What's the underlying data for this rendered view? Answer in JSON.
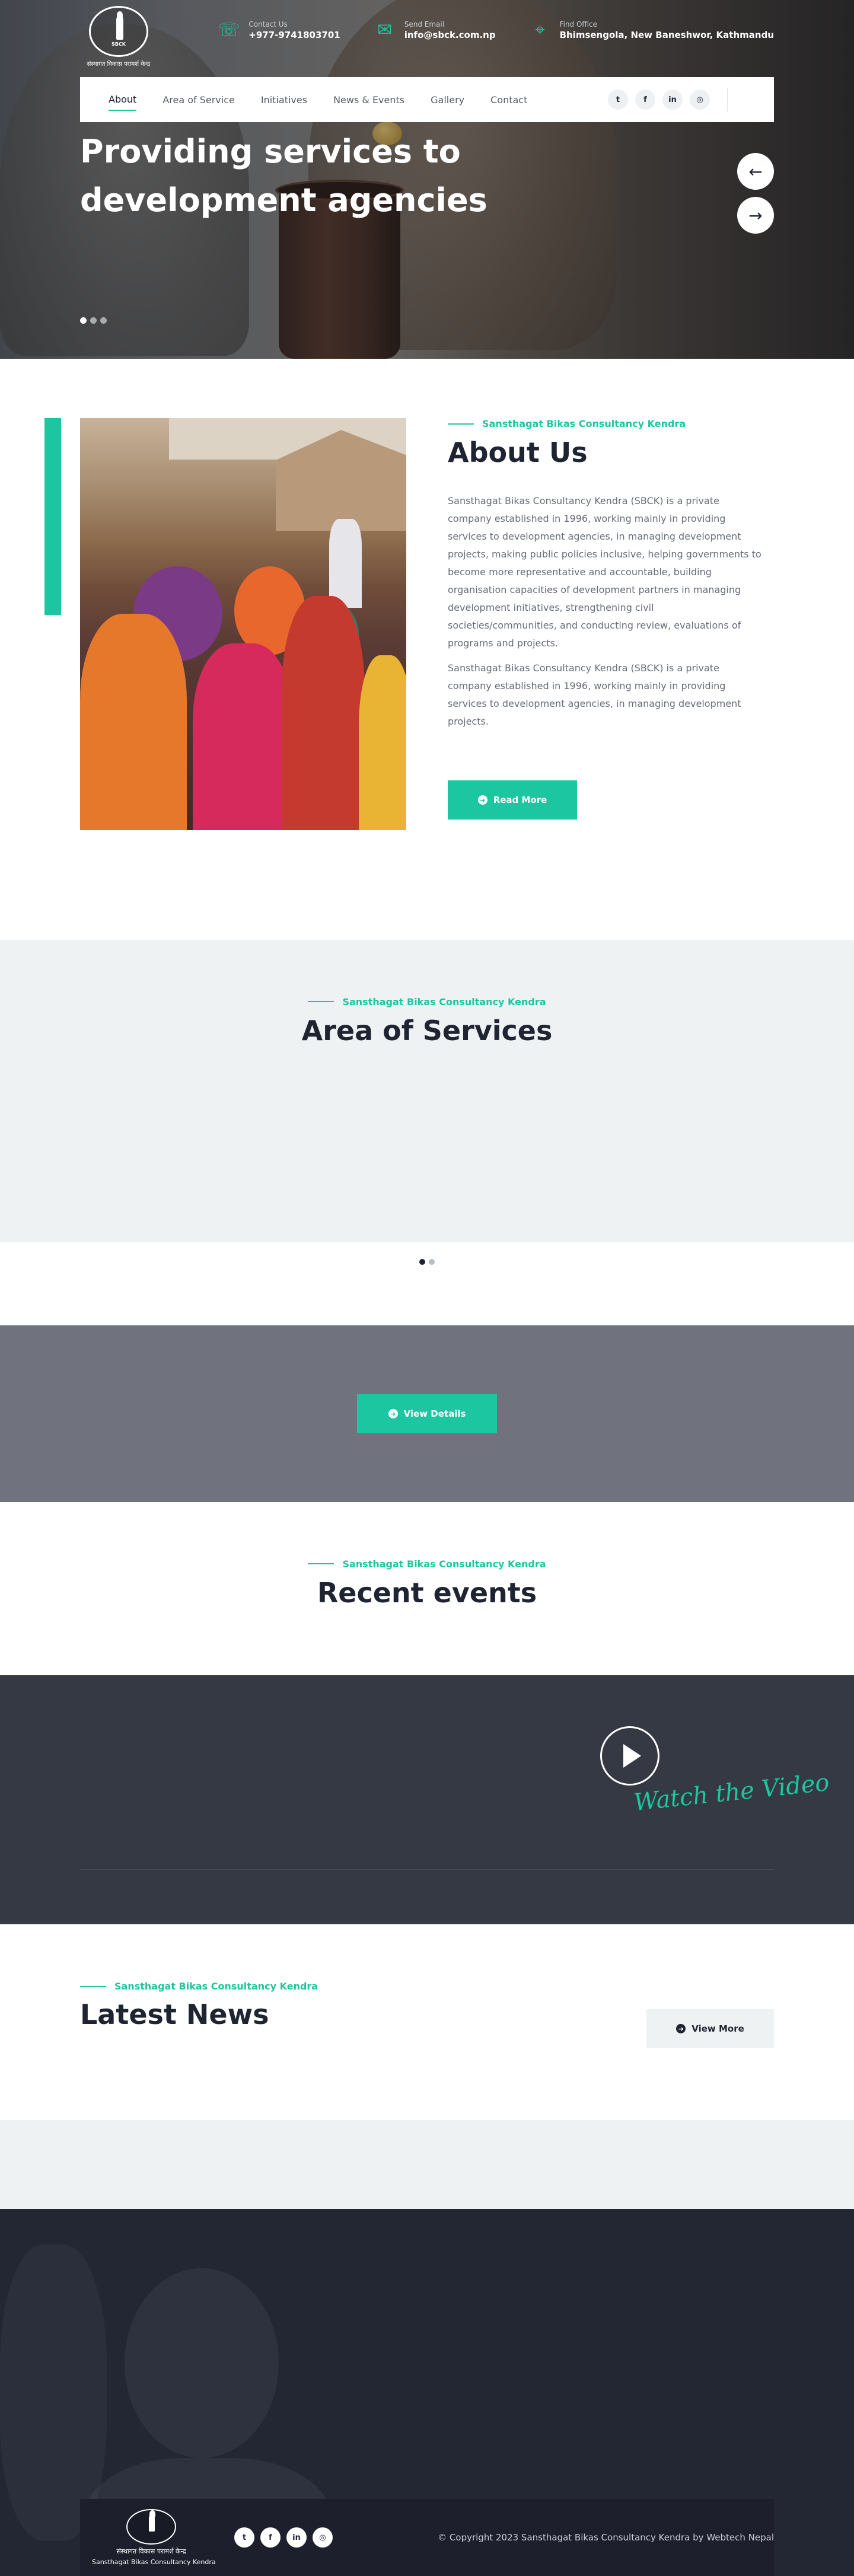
{
  "header": {
    "logo_mark": "SBCK",
    "logo_text": "संस्थागत विकास परामर्श केन्द्र",
    "contacts": [
      {
        "icon": "phone-icon",
        "label": "Contact Us",
        "value": "+977-9741803701"
      },
      {
        "icon": "email-icon",
        "label": "Send Email",
        "value": "info@sbck.com.np"
      },
      {
        "icon": "location-icon",
        "label": "Find Office",
        "value": "Bhimsengola, New Baneshwor, Kathmandu"
      }
    ]
  },
  "nav": {
    "items": [
      "About",
      "Area of Service",
      "Initiatives",
      "News & Events",
      "Gallery",
      "Contact"
    ],
    "socials": [
      "twitter-icon",
      "facebook-icon",
      "linkedin-icon",
      "instagram-icon"
    ],
    "social_glyphs": [
      "t",
      "f",
      "in",
      "◎"
    ]
  },
  "hero": {
    "title": "Providing services to development agencies",
    "prev_glyph": "←",
    "next_glyph": "→"
  },
  "about": {
    "kicker": "Sansthagat Bikas Consultancy Kendra",
    "title": "About Us",
    "para1": "Sansthagat Bikas Consultancy Kendra (SBCK) is a private company established in 1996, working mainly in providing services to development agencies, in managing development projects, making public policies inclusive, helping governments to become more representative and accountable, building organisation capacities of development partners in managing development initiatives, strengthening civil societies/communities, and conducting review, evaluations of programs and projects.",
    "para2": "Sansthagat Bikas Consultancy Kendra (SBCK) is a private company established in 1996, working mainly in providing services to development agencies, in managing development projects.",
    "button": "Read More"
  },
  "services": {
    "kicker": "Sansthagat Bikas Consultancy Kendra",
    "title": "Area of Services"
  },
  "band": {
    "button": "View Details"
  },
  "events": {
    "kicker": "Sansthagat Bikas Consultancy Kendra",
    "title": "Recent events"
  },
  "video": {
    "caption": "Watch the Video"
  },
  "news": {
    "kicker": "Sansthagat Bikas Consultancy Kendra",
    "title": "Latest News",
    "button": "View More"
  },
  "footer": {
    "logo_text": "Sansthagat Bikas Consultancy Kendra",
    "logo_text_np": "संस्थागत विकास परामर्श केन्द्र",
    "copyright": "© Copyright 2023 Sansthagat Bikas Consultancy Kendra by Webtech Nepal"
  },
  "colors": {
    "accent": "#1cc6a0",
    "dark": "#1f2433",
    "band": "#70727e",
    "video_bg": "#353944",
    "footer_bg": "#232734"
  }
}
